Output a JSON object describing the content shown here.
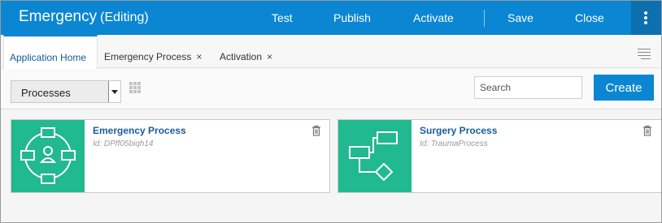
{
  "header": {
    "title": "Emergency",
    "title_suffix": "(Editing)",
    "actions": [
      "Test",
      "Publish",
      "Activate",
      "Save",
      "Close"
    ],
    "more_icon": "vertical-ellipsis-icon"
  },
  "tabs": [
    {
      "label": "Application Home",
      "active": true,
      "closable": false
    },
    {
      "label": "Emergency Process",
      "active": false,
      "closable": true
    },
    {
      "label": "Activation",
      "active": false,
      "closable": true
    }
  ],
  "tab_close_glyph": "×",
  "toolbar": {
    "view_select_value": "Processes",
    "search_placeholder": "Search",
    "create_label": "Create"
  },
  "processes": [
    {
      "name": "Emergency Process",
      "id_text": "Id: DPff05biqh14",
      "icon": "process-cycle-icon"
    },
    {
      "name": "Surgery Process",
      "id_text": "Id: TraumaProcess",
      "icon": "process-flow-icon"
    }
  ],
  "colors": {
    "header_bg": "#0a86d3",
    "accent": "#0a86d3",
    "thumb_bg": "#21b98f",
    "link_text": "#1b5c9c"
  }
}
